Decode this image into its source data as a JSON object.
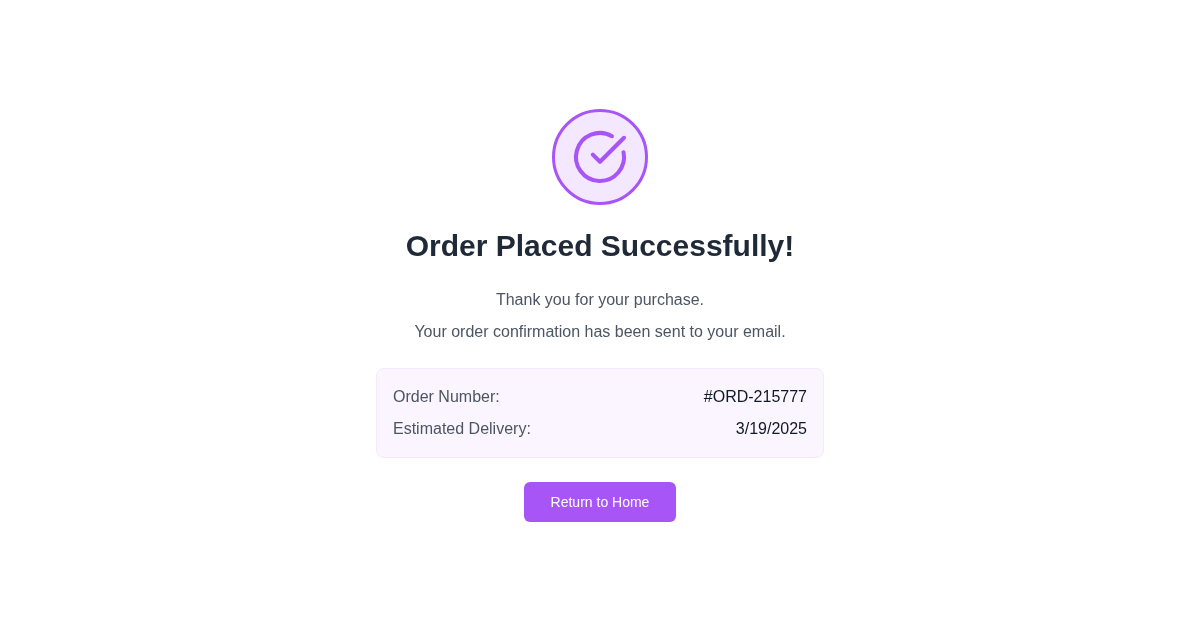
{
  "title": "Order Placed Successfully!",
  "messages": [
    "Thank you for your purchase.",
    "Your order confirmation has been sent to your email."
  ],
  "details": [
    {
      "label": "Order Number:",
      "value": "#ORD-215777"
    },
    {
      "label": "Estimated Delivery:",
      "value": "3/19/2025"
    }
  ],
  "button": {
    "label": "Return to Home"
  }
}
